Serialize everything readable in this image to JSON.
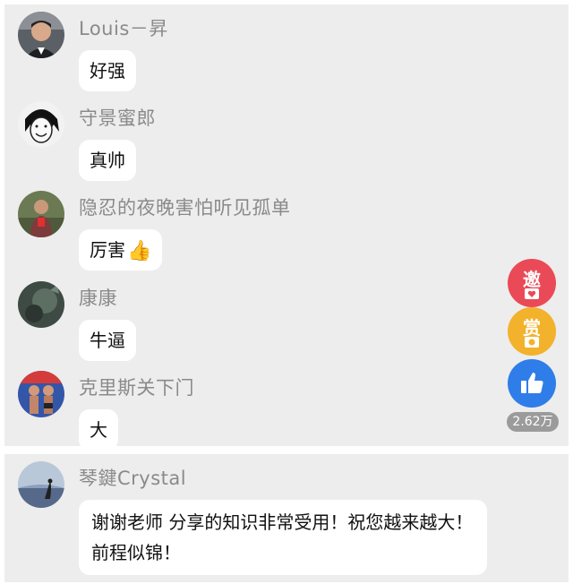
{
  "comments": [
    {
      "name": "Louis－昇",
      "text": "好强"
    },
    {
      "name": "守景蜜郎",
      "text": "真帅"
    },
    {
      "name": "隐忍的夜晚害怕听见孤单",
      "text": "厉害",
      "emoji": "thumbs-up-icon"
    },
    {
      "name": "康康",
      "text": "牛逼"
    },
    {
      "name": "克里斯关下门",
      "text": "大"
    }
  ],
  "highlight_comment": {
    "name": "琴鍵Crystal",
    "text": "谢谢老师 分享的知识非常受用！祝您越来越大！前程似锦！"
  },
  "actions": {
    "invite_label": "邀",
    "reward_label": "赏",
    "like_count": "2.62万"
  },
  "colors": {
    "panel_bg": "#ededed",
    "bubble_bg": "#ffffff",
    "name_text": "#8a8a8a",
    "invite": "#ea4a57",
    "reward": "#f3b22c",
    "like": "#2f7de9",
    "like_badge": "#9b9b9b"
  }
}
